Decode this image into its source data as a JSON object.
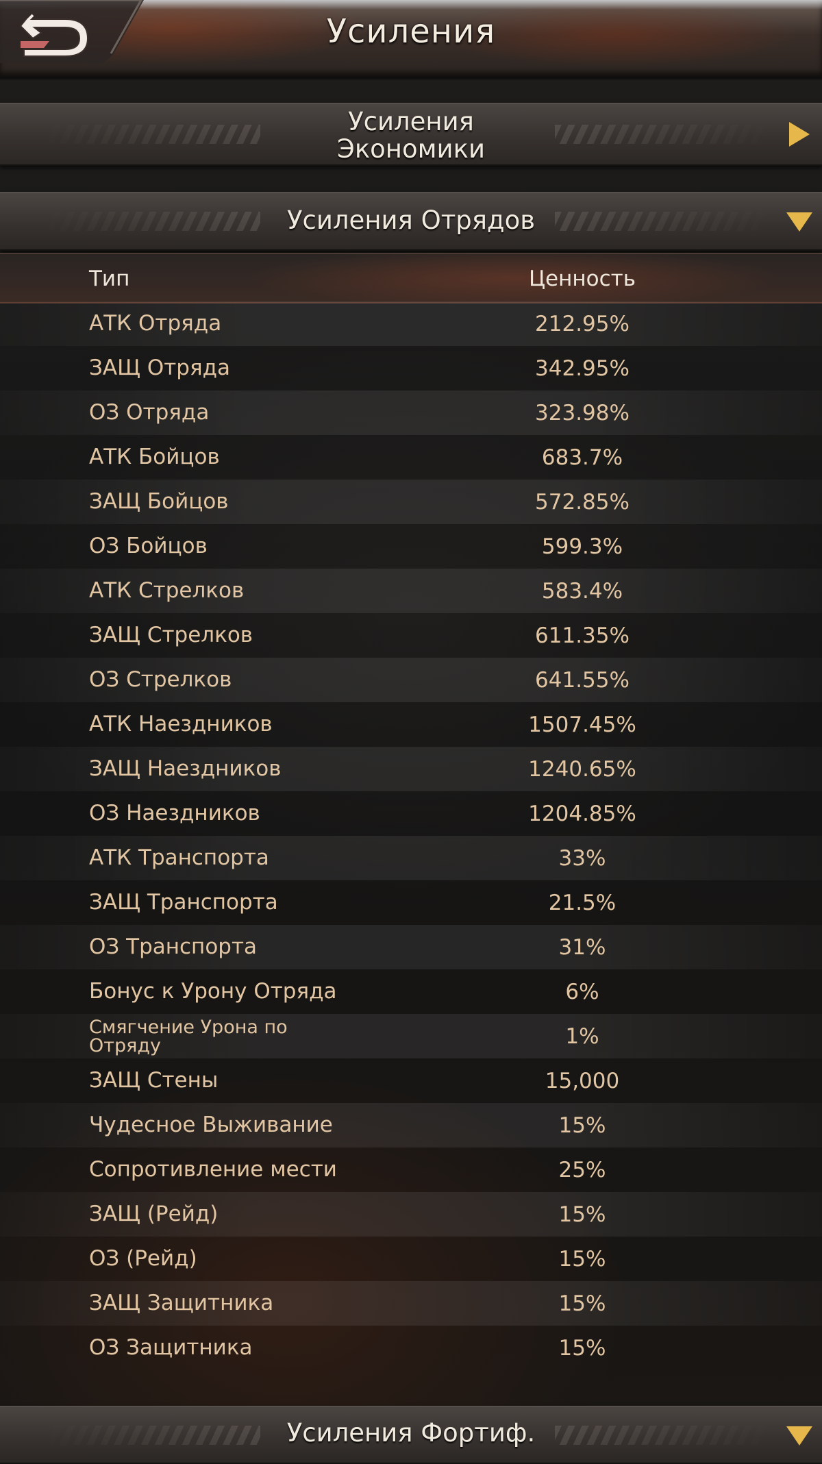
{
  "header": {
    "title": "Усиления",
    "back_icon": "back-arrow-icon"
  },
  "sections": {
    "economy": {
      "label_line1": "Усиления",
      "label_line2": "Экономики",
      "state": "collapsed"
    },
    "troops": {
      "label": "Усиления Отрядов",
      "state": "expanded"
    },
    "fort": {
      "label": "Усиления Фортиф.",
      "state": "expanded"
    }
  },
  "table": {
    "columns": {
      "type": "Тип",
      "value": "Ценность"
    },
    "rows": [
      {
        "name": "АТК Отряда",
        "value": "212.95%"
      },
      {
        "name": "ЗАЩ Отряда",
        "value": "342.95%"
      },
      {
        "name": "ОЗ Отряда",
        "value": "323.98%"
      },
      {
        "name": "АТК Бойцов",
        "value": "683.7%"
      },
      {
        "name": "ЗАЩ Бойцов",
        "value": "572.85%"
      },
      {
        "name": "ОЗ Бойцов",
        "value": "599.3%"
      },
      {
        "name": "АТК Стрелков",
        "value": "583.4%"
      },
      {
        "name": "ЗАЩ Стрелков",
        "value": "611.35%"
      },
      {
        "name": "ОЗ Стрелков",
        "value": "641.55%"
      },
      {
        "name": "АТК Наездников",
        "value": "1507.45%"
      },
      {
        "name": "ЗАЩ Наездников",
        "value": "1240.65%"
      },
      {
        "name": "ОЗ Наездников",
        "value": "1204.85%"
      },
      {
        "name": "АТК Транспорта",
        "value": "33%"
      },
      {
        "name": "ЗАЩ Транспорта",
        "value": "21.5%"
      },
      {
        "name": "ОЗ Транспорта",
        "value": "31%"
      },
      {
        "name": "Бонус к Урону Отряда",
        "value": "6%"
      },
      {
        "name_line1": "Смягчение Урона по",
        "name_line2": "Отряду",
        "value": "1%"
      },
      {
        "name": "ЗАЩ Стены",
        "value": "15,000"
      },
      {
        "name": "Чудесное Выживание",
        "value": "15%"
      },
      {
        "name": "Сопротивление мести",
        "value": "25%"
      },
      {
        "name": "ЗАЩ (Рейд)",
        "value": "15%"
      },
      {
        "name": "ОЗ (Рейд)",
        "value": "15%"
      },
      {
        "name": "ЗАЩ Защитника",
        "value": "15%"
      },
      {
        "name": "ОЗ Защитника",
        "value": "15%"
      }
    ]
  },
  "colors": {
    "title_text": "#f3ecdf",
    "row_text": "#e2c6a3",
    "arrow_gold": "#e6b74a"
  }
}
